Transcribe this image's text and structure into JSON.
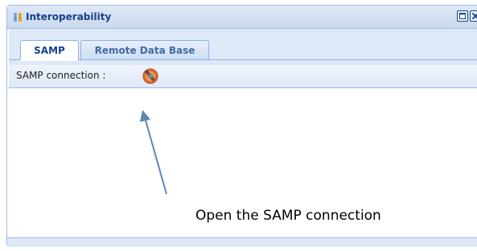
{
  "window": {
    "title": "Interoperability",
    "icons": {
      "title_icon": "people-icon",
      "maximize": "maximize-icon",
      "close": "close-icon"
    }
  },
  "tabs": [
    {
      "label": "SAMP",
      "active": true
    },
    {
      "label": "Remote Data Base",
      "active": false
    }
  ],
  "toolbar": {
    "label": "SAMP connection :",
    "connect_icon": "plug-connect-icon"
  },
  "annotation": {
    "text": "Open the SAMP connection"
  },
  "colors": {
    "title_text": "#15428b",
    "border": "#99bbe8",
    "panel_bg": "#dfe8f6",
    "arrow": "#5b87b5"
  }
}
